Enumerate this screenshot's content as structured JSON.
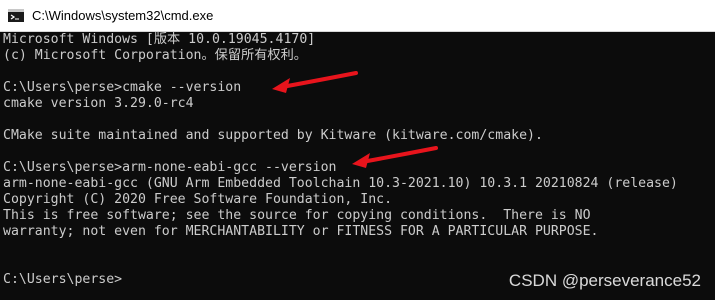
{
  "window": {
    "title": "C:\\Windows\\system32\\cmd.exe",
    "icon": "cmd-icon"
  },
  "terminal": {
    "lines": [
      "Microsoft Windows [版本 10.0.19045.4170]",
      "(c) Microsoft Corporation。保留所有权利。",
      "",
      "C:\\Users\\perse>cmake --version",
      "cmake version 3.29.0-rc4",
      "",
      "CMake suite maintained and supported by Kitware (kitware.com/cmake).",
      "",
      "C:\\Users\\perse>arm-none-eabi-gcc --version",
      "arm-none-eabi-gcc (GNU Arm Embedded Toolchain 10.3-2021.10) 10.3.1 20210824 (release)",
      "Copyright (C) 2020 Free Software Foundation, Inc.",
      "This is free software; see the source for copying conditions.  There is NO",
      "warranty; not even for MERCHANTABILITY or FITNESS FOR A PARTICULAR PURPOSE.",
      "",
      "",
      "C:\\Users\\perse>"
    ]
  },
  "annotations": {
    "arrow_color": "#e8141c"
  },
  "watermark": "CSDN @perseverance52",
  "colors": {
    "terminal_bg": "#0c0c0c",
    "terminal_fg": "#cccccc",
    "titlebar_bg": "#ffffff"
  }
}
